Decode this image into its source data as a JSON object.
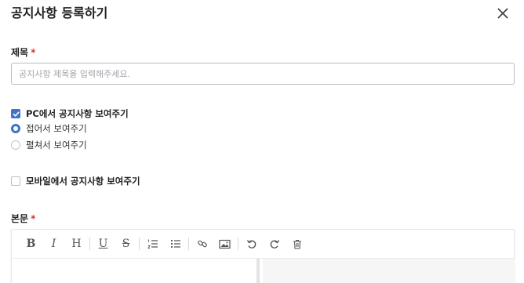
{
  "modal": {
    "title": "공지사항 등록하기",
    "close_icon": "close-icon"
  },
  "form": {
    "title_field": {
      "label": "제목",
      "required_mark": "*",
      "placeholder": "공지사항 제목을 입력해주세요.",
      "value": ""
    },
    "pc_display": {
      "label": "PC에서 공지사항 보여주기",
      "checked": true,
      "options": [
        {
          "label": "접어서 보여주기",
          "selected": true
        },
        {
          "label": "펼쳐서 보여주기",
          "selected": false
        }
      ]
    },
    "mobile_display": {
      "label": "모바일에서 공지사항 보여주기",
      "checked": false
    },
    "body_field": {
      "label": "본문",
      "required_mark": "*"
    }
  },
  "editor": {
    "toolbar": [
      {
        "icon": "bold-icon",
        "glyph": "B"
      },
      {
        "icon": "italic-icon",
        "glyph": "I"
      },
      {
        "icon": "heading-icon",
        "glyph": "H"
      },
      {
        "icon": "underline-icon",
        "glyph": "U"
      },
      {
        "icon": "strikethrough-icon",
        "glyph": "S"
      },
      {
        "icon": "ordered-list-icon"
      },
      {
        "icon": "bullet-list-icon"
      },
      {
        "icon": "link-icon"
      },
      {
        "icon": "image-icon"
      },
      {
        "icon": "undo-icon"
      },
      {
        "icon": "redo-icon"
      },
      {
        "icon": "trash-icon"
      }
    ]
  },
  "colors": {
    "accent": "#3f74c9",
    "required": "#e03131"
  }
}
